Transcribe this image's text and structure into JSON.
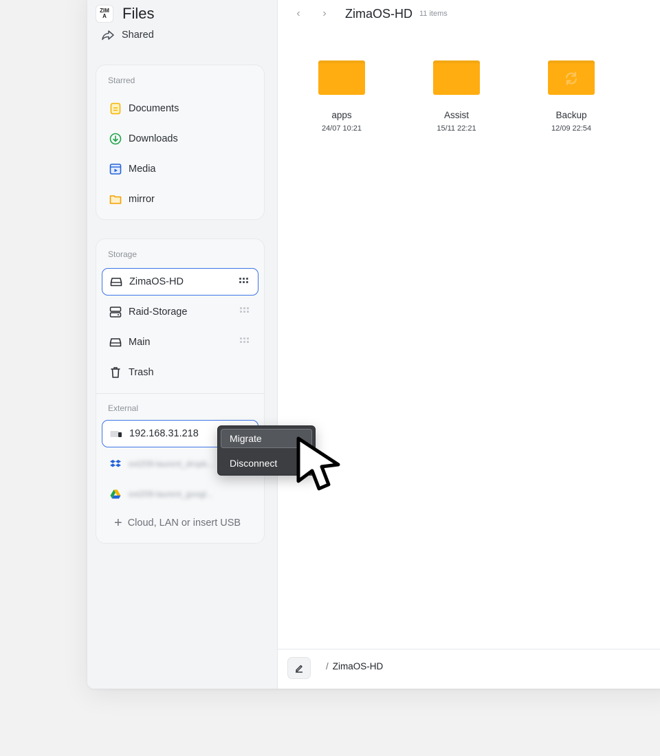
{
  "app": {
    "logo_text": "ZIMA",
    "title": "Files"
  },
  "sidebar": {
    "shared_label": "Shared",
    "starred": {
      "section_label": "Starred",
      "items": [
        {
          "label": "Documents",
          "icon": "document-icon",
          "color": "#f5b400"
        },
        {
          "label": "Downloads",
          "icon": "download-icon",
          "color": "#1fa44a"
        },
        {
          "label": "Media",
          "icon": "media-icon",
          "color": "#2563d9"
        },
        {
          "label": "mirror",
          "icon": "folder-icon",
          "color": "#f5a000"
        }
      ]
    },
    "storage": {
      "section_label": "Storage",
      "items": [
        {
          "label": "ZimaOS-HD",
          "icon": "drive-icon",
          "active": true
        },
        {
          "label": "Raid-Storage",
          "icon": "raid-icon"
        },
        {
          "label": "Main",
          "icon": "drive-icon"
        },
        {
          "label": "Trash",
          "icon": "trash-icon"
        }
      ]
    },
    "external": {
      "section_label": "External",
      "items": [
        {
          "label": "192.168.31.218",
          "icon": "network-drive-icon",
          "active": true
        },
        {
          "label": "ext209-laurent_dropb...",
          "icon": "dropbox-icon",
          "color": "#2563d9"
        },
        {
          "label": "ext209-laurent_googl...",
          "icon": "google-drive-icon"
        }
      ],
      "add_label": "Cloud, LAN or insert USB"
    }
  },
  "header": {
    "title": "ZimaOS-HD",
    "item_count": "11 items"
  },
  "files": [
    {
      "name": "apps",
      "date": "24/07 10:21",
      "icon": "folder-icon"
    },
    {
      "name": "Assist",
      "date": "15/11 22:21",
      "icon": "folder-icon"
    },
    {
      "name": "Backup",
      "date": "12/09 22:54",
      "icon": "folder-sync-icon"
    }
  ],
  "footer": {
    "path": "ZimaOS-HD",
    "separator": "/"
  },
  "context_menu": {
    "items": [
      "Migrate",
      "Disconnect"
    ],
    "highlighted": "Migrate"
  },
  "colors": {
    "accent": "#3b74e6",
    "folder": "#ffad10"
  }
}
